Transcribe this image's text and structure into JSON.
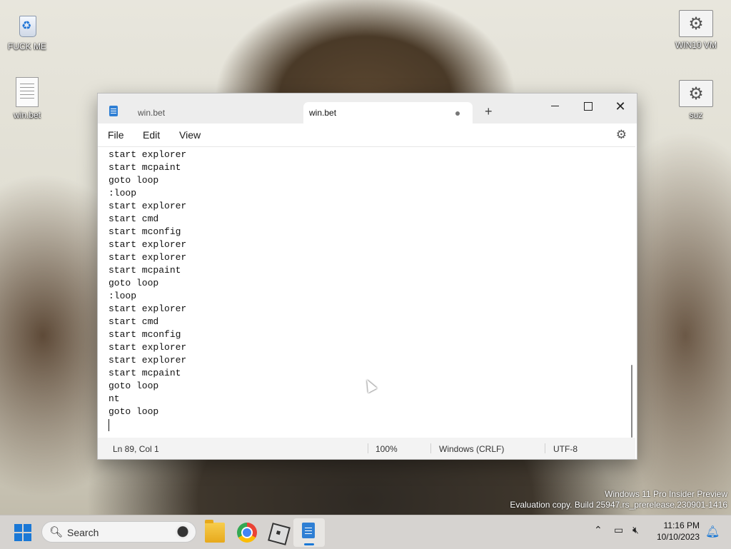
{
  "desktop": {
    "icons": [
      {
        "label": "FUCK ME",
        "icon": "recycle-bin-icon"
      },
      {
        "label": "win.bet",
        "icon": "text-file-icon"
      },
      {
        "label": "WIN10 VM",
        "icon": "settings-shortcut-icon"
      },
      {
        "label": "suz",
        "icon": "settings-shortcut-icon"
      }
    ],
    "watermark": {
      "line1": "Windows 11 Pro Insider Preview",
      "line2": "Evaluation copy. Build 25947.rs_prerelease.230901-1416"
    }
  },
  "notepad": {
    "tabs": [
      {
        "label": "win.bet",
        "active": false
      },
      {
        "label": "win.bet",
        "active": true,
        "unsaved": true
      }
    ],
    "new_tab": "+",
    "menu": [
      "File",
      "Edit",
      "View"
    ],
    "lines": [
      "start explorer",
      "start mcpaint",
      "goto loop",
      ":loop",
      "start explorer",
      "start cmd",
      "start mconfig",
      "start explorer",
      "start explorer",
      "start mcpaint",
      "goto loop",
      ":loop",
      "start explorer",
      "start cmd",
      "start mconfig",
      "start explorer",
      "start explorer",
      "start mcpaint",
      "goto loop",
      "nt",
      "goto loop"
    ],
    "status": {
      "position": "Ln 89, Col 1",
      "zoom": "100%",
      "line_ending": "Windows (CRLF)",
      "encoding": "UTF-8"
    }
  },
  "taskbar": {
    "search_placeholder": "Search",
    "apps": [
      "file-explorer-icon",
      "chrome-icon",
      "roblox-icon",
      "notepad-icon"
    ],
    "time": "11:16 PM",
    "date": "10/10/2023"
  },
  "colors": {
    "accent": "#1a78d6",
    "notepad_icon": "#2f7fd4"
  }
}
